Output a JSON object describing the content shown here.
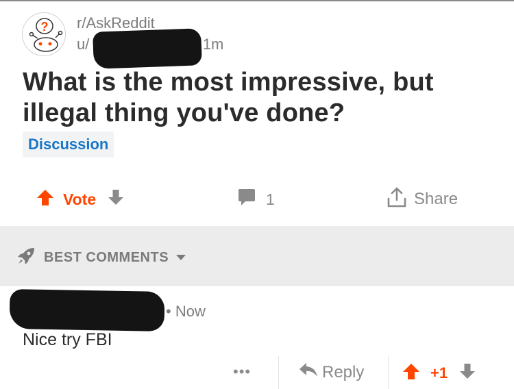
{
  "post": {
    "subreddit": "r/AskReddit",
    "user_prefix": "u/",
    "age": "• 1m",
    "title": "What is the most impressive, but illegal thing you've done?",
    "flair": "Discussion"
  },
  "actions": {
    "vote_label": "Vote",
    "comment_count": "1",
    "share_label": "Share"
  },
  "sort": {
    "label": "BEST COMMENTS"
  },
  "comment": {
    "age": "• Now",
    "body": "Nice try FBI",
    "more_label": "•••",
    "reply_label": "Reply",
    "score": "+1"
  },
  "colors": {
    "upvote": "#ff4500",
    "flair_text": "#1976c7",
    "muted": "#8a8a8a"
  }
}
